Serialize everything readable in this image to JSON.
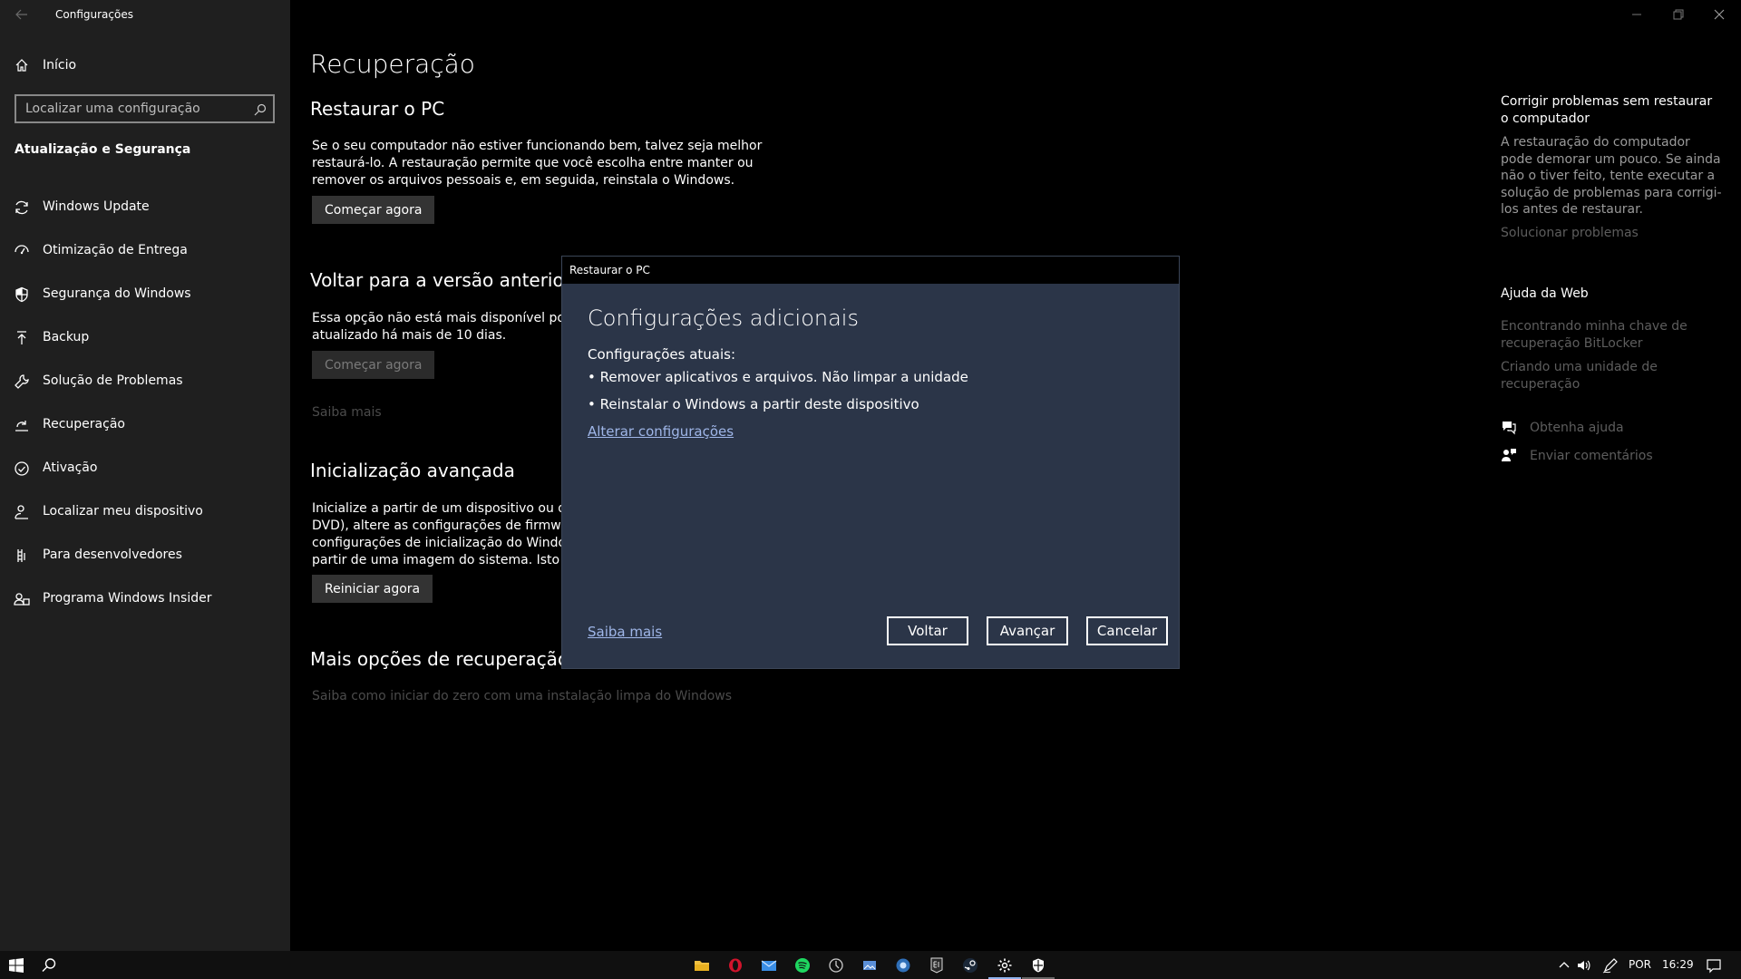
{
  "window": {
    "app_title": "Configurações"
  },
  "sidebar": {
    "home_label": "Início",
    "search_placeholder": "Localizar uma configuração",
    "section_title": "Atualização e Segurança",
    "items": [
      {
        "label": "Windows Update",
        "icon": "sync-icon"
      },
      {
        "label": "Otimização de Entrega",
        "icon": "delivery-optimization-icon"
      },
      {
        "label": "Segurança do Windows",
        "icon": "shield-icon"
      },
      {
        "label": "Backup",
        "icon": "backup-arrow-icon"
      },
      {
        "label": "Solução de Problemas",
        "icon": "wrench-icon"
      },
      {
        "label": "Recuperação",
        "icon": "recovery-icon"
      },
      {
        "label": "Ativação",
        "icon": "check-circle-icon"
      },
      {
        "label": "Localizar meu dispositivo",
        "icon": "person-location-icon"
      },
      {
        "label": "Para desenvolvedores",
        "icon": "developer-icon"
      },
      {
        "label": "Programa Windows Insider",
        "icon": "insider-icon"
      }
    ],
    "active_item": "Recuperação"
  },
  "main": {
    "page_title": "Recuperação",
    "reset": {
      "title": "Restaurar o PC",
      "description": [
        "Se o seu computador não estiver funcionando bem, talvez seja melhor",
        "restaurá-lo. A restauração permite que você escolha entre manter ou",
        "remover os arquivos pessoais e, em seguida, reinstala o Windows."
      ],
      "button": "Começar agora"
    },
    "goback": {
      "title": "Voltar para a versão anterior do",
      "description": [
        "Essa opção não está mais disponível porque",
        "atualizado há mais de 10 dias."
      ],
      "button": "Começar agora",
      "link": "Saiba mais"
    },
    "advanced": {
      "title": "Inicialização avançada",
      "description": [
        "Inicialize a partir de um dispositivo ou disco c",
        "DVD), altere as configurações de firmware do",
        "configurações de inicialização do Windows c",
        "partir de uma imagem do sistema. Isto irá rei"
      ],
      "button": "Reiniciar agora"
    },
    "more": {
      "title": "Mais opções de recuperação",
      "link": "Saiba como iniciar do zero com uma instalação limpa do Windows"
    }
  },
  "right_pane": {
    "fix_title": "Corrigir problemas sem restaurar o computador",
    "fix_text": "A restauração do computador pode demorar um pouco. Se ainda não o tiver feito, tente executar a solução de problemas para corrigi-los antes de restaurar.",
    "fix_link": "Solucionar problemas",
    "web_help_title": "Ajuda da Web",
    "web_links": [
      "Encontrando minha chave de recuperação BitLocker",
      "Criando uma unidade de recuperação"
    ],
    "get_help": "Obtenha ajuda",
    "feedback": "Enviar comentários"
  },
  "dialog": {
    "window_title": "Restaurar o PC",
    "heading": "Configurações adicionais",
    "current_label": "Configurações atuais:",
    "bullets": [
      "• Remover aplicativos e arquivos. Não limpar a unidade",
      "•  Reinstalar o Windows a partir deste dispositivo"
    ],
    "change_link": "Alterar configurações",
    "learn_more": "Saiba mais",
    "buttons": {
      "back": "Voltar",
      "next": "Avançar",
      "cancel": "Cancelar"
    }
  },
  "taskbar": {
    "language": "POR",
    "time": "16:29",
    "pinned_icons": [
      "file-explorer-icon",
      "opera-icon",
      "mail-icon",
      "spotify-icon",
      "misc-app-icon",
      "photos-icon",
      "app-icon",
      "epic-games-icon",
      "steam-icon",
      "settings-icon",
      "security-icon"
    ],
    "accent": "#8fb2ec"
  },
  "colors": {
    "sidebar_bg": "#1f1f1f",
    "main_bg": "#000000",
    "dialog_bg": "#2b3548",
    "link": "#9fb6e8"
  }
}
